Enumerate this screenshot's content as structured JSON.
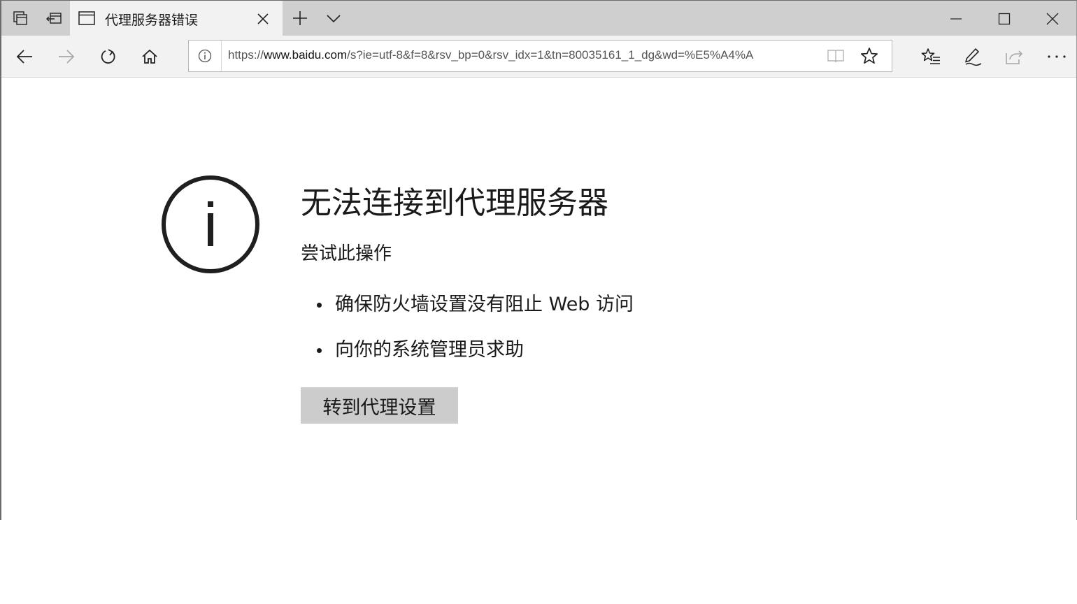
{
  "tab": {
    "title": "代理服务器错误"
  },
  "address": {
    "url_prefix": "https://",
    "url_host": "www.baidu.com",
    "url_rest": "/s?ie=utf-8&f=8&rsv_bp=0&rsv_idx=1&tn=80035161_1_dg&wd=%E5%A4%A"
  },
  "icons": {
    "tabs_aside": "tabs-aside-icon",
    "set_aside": "set-aside-icon",
    "new_tab": "plus-icon",
    "tab_list": "chevron-down-icon",
    "back": "back-arrow-icon",
    "forward": "forward-arrow-icon",
    "refresh": "refresh-icon",
    "home": "home-icon",
    "favorites": "favorites-icon",
    "notes": "pen-icon",
    "share": "share-icon",
    "more": "more-icon"
  },
  "error": {
    "title": "无法连接到代理服务器",
    "subtitle": "尝试此操作",
    "suggestions": [
      "确保防火墙设置没有阻止 Web 访问",
      "向你的系统管理员求助"
    ],
    "button_label": "转到代理设置"
  }
}
